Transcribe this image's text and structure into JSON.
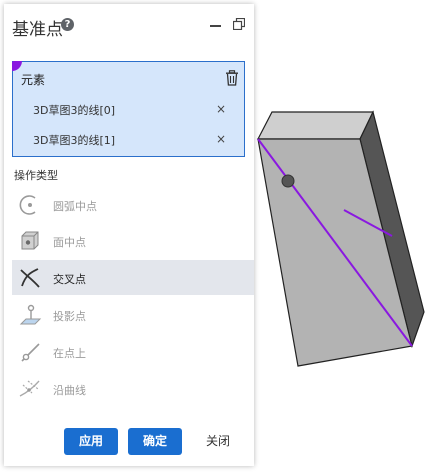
{
  "panel": {
    "title": "基准点",
    "help_icon_glyph": "?",
    "selection": {
      "title": "元素",
      "items": [
        {
          "label": "3D草图3的线[0]",
          "remove": "×"
        },
        {
          "label": "3D草图3的线[1]",
          "remove": "×"
        }
      ]
    },
    "operation_type_label": "操作类型",
    "operations": [
      {
        "label": "圆弧中点",
        "icon": "arc-midpoint-icon",
        "selected": false
      },
      {
        "label": "面中点",
        "icon": "face-midpoint-icon",
        "selected": false
      },
      {
        "label": "交叉点",
        "icon": "intersection-icon",
        "selected": true
      },
      {
        "label": "投影点",
        "icon": "projection-point-icon",
        "selected": false
      },
      {
        "label": "在点上",
        "icon": "on-point-icon",
        "selected": false
      },
      {
        "label": "沿曲线",
        "icon": "along-curve-icon",
        "selected": false
      }
    ],
    "buttons": {
      "apply": "应用",
      "ok": "确定",
      "close": "关闭"
    }
  },
  "colors": {
    "accent": "#1a6ed0",
    "selection_bg": "#d5e6fb",
    "selection_marker": "#8a18e0",
    "sketch_line": "#8a18e0",
    "box_front": "#b3b3b3",
    "box_top": "#cfcfcf",
    "box_side": "#555555"
  }
}
